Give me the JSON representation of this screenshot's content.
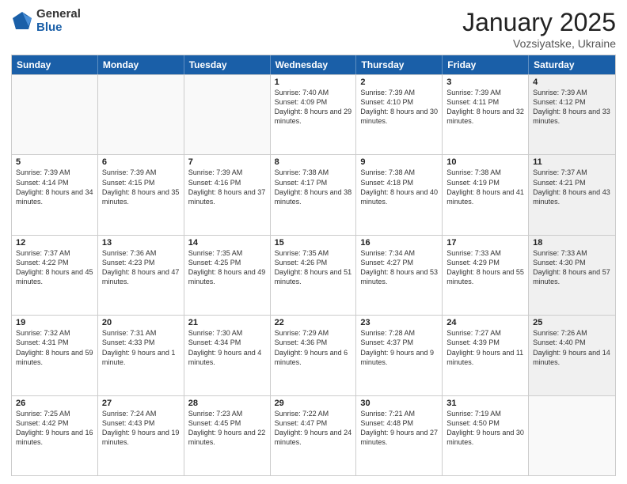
{
  "logo": {
    "general": "General",
    "blue": "Blue"
  },
  "title": "January 2025",
  "location": "Vozsiyatske, Ukraine",
  "days": [
    "Sunday",
    "Monday",
    "Tuesday",
    "Wednesday",
    "Thursday",
    "Friday",
    "Saturday"
  ],
  "rows": [
    [
      {
        "day": "",
        "empty": true
      },
      {
        "day": "",
        "empty": true
      },
      {
        "day": "",
        "empty": true
      },
      {
        "day": "1",
        "sunrise": "7:40 AM",
        "sunset": "4:09 PM",
        "daylight": "8 hours and 29 minutes."
      },
      {
        "day": "2",
        "sunrise": "7:39 AM",
        "sunset": "4:10 PM",
        "daylight": "8 hours and 30 minutes."
      },
      {
        "day": "3",
        "sunrise": "7:39 AM",
        "sunset": "4:11 PM",
        "daylight": "8 hours and 32 minutes."
      },
      {
        "day": "4",
        "sunrise": "7:39 AM",
        "sunset": "4:12 PM",
        "daylight": "8 hours and 33 minutes.",
        "shaded": true
      }
    ],
    [
      {
        "day": "5",
        "sunrise": "7:39 AM",
        "sunset": "4:14 PM",
        "daylight": "8 hours and 34 minutes."
      },
      {
        "day": "6",
        "sunrise": "7:39 AM",
        "sunset": "4:15 PM",
        "daylight": "8 hours and 35 minutes."
      },
      {
        "day": "7",
        "sunrise": "7:39 AM",
        "sunset": "4:16 PM",
        "daylight": "8 hours and 37 minutes."
      },
      {
        "day": "8",
        "sunrise": "7:38 AM",
        "sunset": "4:17 PM",
        "daylight": "8 hours and 38 minutes."
      },
      {
        "day": "9",
        "sunrise": "7:38 AM",
        "sunset": "4:18 PM",
        "daylight": "8 hours and 40 minutes."
      },
      {
        "day": "10",
        "sunrise": "7:38 AM",
        "sunset": "4:19 PM",
        "daylight": "8 hours and 41 minutes."
      },
      {
        "day": "11",
        "sunrise": "7:37 AM",
        "sunset": "4:21 PM",
        "daylight": "8 hours and 43 minutes.",
        "shaded": true
      }
    ],
    [
      {
        "day": "12",
        "sunrise": "7:37 AM",
        "sunset": "4:22 PM",
        "daylight": "8 hours and 45 minutes."
      },
      {
        "day": "13",
        "sunrise": "7:36 AM",
        "sunset": "4:23 PM",
        "daylight": "8 hours and 47 minutes."
      },
      {
        "day": "14",
        "sunrise": "7:35 AM",
        "sunset": "4:25 PM",
        "daylight": "8 hours and 49 minutes."
      },
      {
        "day": "15",
        "sunrise": "7:35 AM",
        "sunset": "4:26 PM",
        "daylight": "8 hours and 51 minutes."
      },
      {
        "day": "16",
        "sunrise": "7:34 AM",
        "sunset": "4:27 PM",
        "daylight": "8 hours and 53 minutes."
      },
      {
        "day": "17",
        "sunrise": "7:33 AM",
        "sunset": "4:29 PM",
        "daylight": "8 hours and 55 minutes."
      },
      {
        "day": "18",
        "sunrise": "7:33 AM",
        "sunset": "4:30 PM",
        "daylight": "8 hours and 57 minutes.",
        "shaded": true
      }
    ],
    [
      {
        "day": "19",
        "sunrise": "7:32 AM",
        "sunset": "4:31 PM",
        "daylight": "8 hours and 59 minutes."
      },
      {
        "day": "20",
        "sunrise": "7:31 AM",
        "sunset": "4:33 PM",
        "daylight": "9 hours and 1 minute."
      },
      {
        "day": "21",
        "sunrise": "7:30 AM",
        "sunset": "4:34 PM",
        "daylight": "9 hours and 4 minutes."
      },
      {
        "day": "22",
        "sunrise": "7:29 AM",
        "sunset": "4:36 PM",
        "daylight": "9 hours and 6 minutes."
      },
      {
        "day": "23",
        "sunrise": "7:28 AM",
        "sunset": "4:37 PM",
        "daylight": "9 hours and 9 minutes."
      },
      {
        "day": "24",
        "sunrise": "7:27 AM",
        "sunset": "4:39 PM",
        "daylight": "9 hours and 11 minutes."
      },
      {
        "day": "25",
        "sunrise": "7:26 AM",
        "sunset": "4:40 PM",
        "daylight": "9 hours and 14 minutes.",
        "shaded": true
      }
    ],
    [
      {
        "day": "26",
        "sunrise": "7:25 AM",
        "sunset": "4:42 PM",
        "daylight": "9 hours and 16 minutes."
      },
      {
        "day": "27",
        "sunrise": "7:24 AM",
        "sunset": "4:43 PM",
        "daylight": "9 hours and 19 minutes."
      },
      {
        "day": "28",
        "sunrise": "7:23 AM",
        "sunset": "4:45 PM",
        "daylight": "9 hours and 22 minutes."
      },
      {
        "day": "29",
        "sunrise": "7:22 AM",
        "sunset": "4:47 PM",
        "daylight": "9 hours and 24 minutes."
      },
      {
        "day": "30",
        "sunrise": "7:21 AM",
        "sunset": "4:48 PM",
        "daylight": "9 hours and 27 minutes."
      },
      {
        "day": "31",
        "sunrise": "7:19 AM",
        "sunset": "4:50 PM",
        "daylight": "9 hours and 30 minutes."
      },
      {
        "day": "",
        "empty": true,
        "shaded": true
      }
    ]
  ]
}
